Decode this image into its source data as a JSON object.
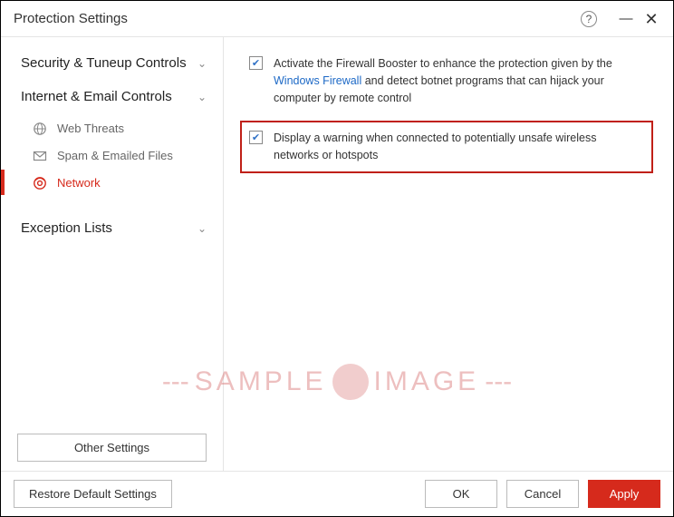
{
  "window": {
    "title": "Protection Settings",
    "help": "?",
    "minimize": "—",
    "close": "✕"
  },
  "sidebar": {
    "sections": [
      {
        "label": "Security & Tuneup Controls",
        "items": []
      },
      {
        "label": "Internet & Email Controls",
        "items": [
          {
            "label": "Web Threats",
            "icon": "globe",
            "active": false
          },
          {
            "label": "Spam & Emailed Files",
            "icon": "mail",
            "active": false
          },
          {
            "label": "Network",
            "icon": "network",
            "active": true
          }
        ]
      },
      {
        "label": "Exception Lists",
        "items": []
      }
    ],
    "other_settings": "Other Settings"
  },
  "options": {
    "firewall_booster": {
      "checked": true,
      "text_pre": "Activate the Firewall Booster to enhance the protection given by the ",
      "link": "Windows Firewall",
      "text_post": " and detect botnet programs that can hijack your computer by remote control"
    },
    "wifi_warning": {
      "checked": true,
      "text": "Display a warning when connected to potentially unsafe wireless networks or hotspots"
    }
  },
  "footer": {
    "restore": "Restore Default Settings",
    "ok": "OK",
    "cancel": "Cancel",
    "apply": "Apply"
  },
  "watermark": {
    "left": "SAMPLE",
    "right": "IMAGE",
    "dashes": "---"
  }
}
